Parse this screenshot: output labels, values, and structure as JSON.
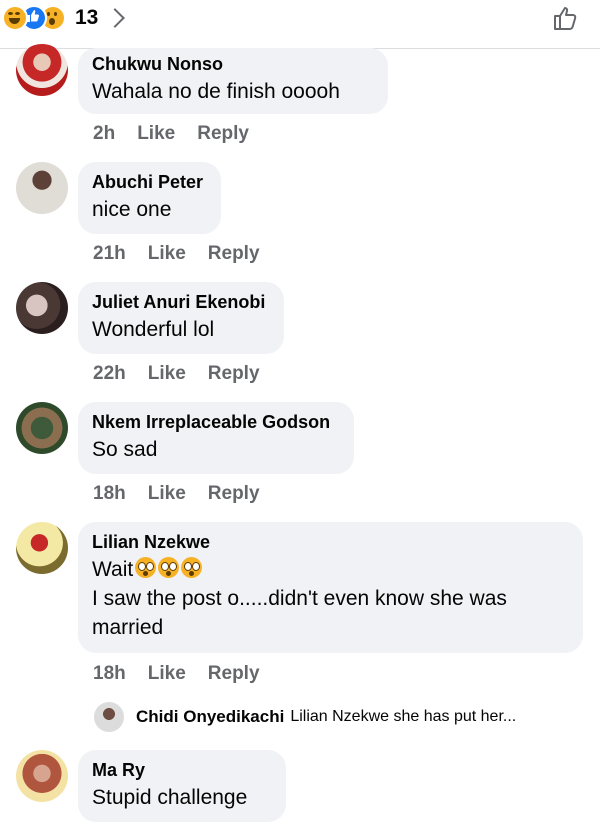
{
  "reactions": {
    "count": "13",
    "icons": [
      "haha-icon",
      "like-icon",
      "wow-icon"
    ]
  },
  "comments": [
    {
      "name": "Chukwu Nonso",
      "text": "Wahala no de finish ooooh",
      "time": "2h",
      "like": "Like",
      "reply": "Reply"
    },
    {
      "name": "Abuchi Peter",
      "text": "nice one",
      "time": "21h",
      "like": "Like",
      "reply": "Reply"
    },
    {
      "name": "Juliet Anuri Ekenobi",
      "text": "Wonderful lol",
      "time": "22h",
      "like": "Like",
      "reply": "Reply"
    },
    {
      "name": "Nkem Irreplaceable Godson",
      "text": "So sad",
      "time": "18h",
      "like": "Like",
      "reply": "Reply"
    },
    {
      "name": "Lilian Nzekwe",
      "text": "Wait",
      "text2": "I saw the post o.....didn't even know she was married",
      "time": "18h",
      "like": "Like",
      "reply": "Reply"
    },
    {
      "name": "Ma Ry",
      "text": "Stupid challenge"
    }
  ],
  "reply_preview": {
    "name": "Chidi Onyedikachi",
    "text": "Lilian Nzekwe she has put her..."
  }
}
